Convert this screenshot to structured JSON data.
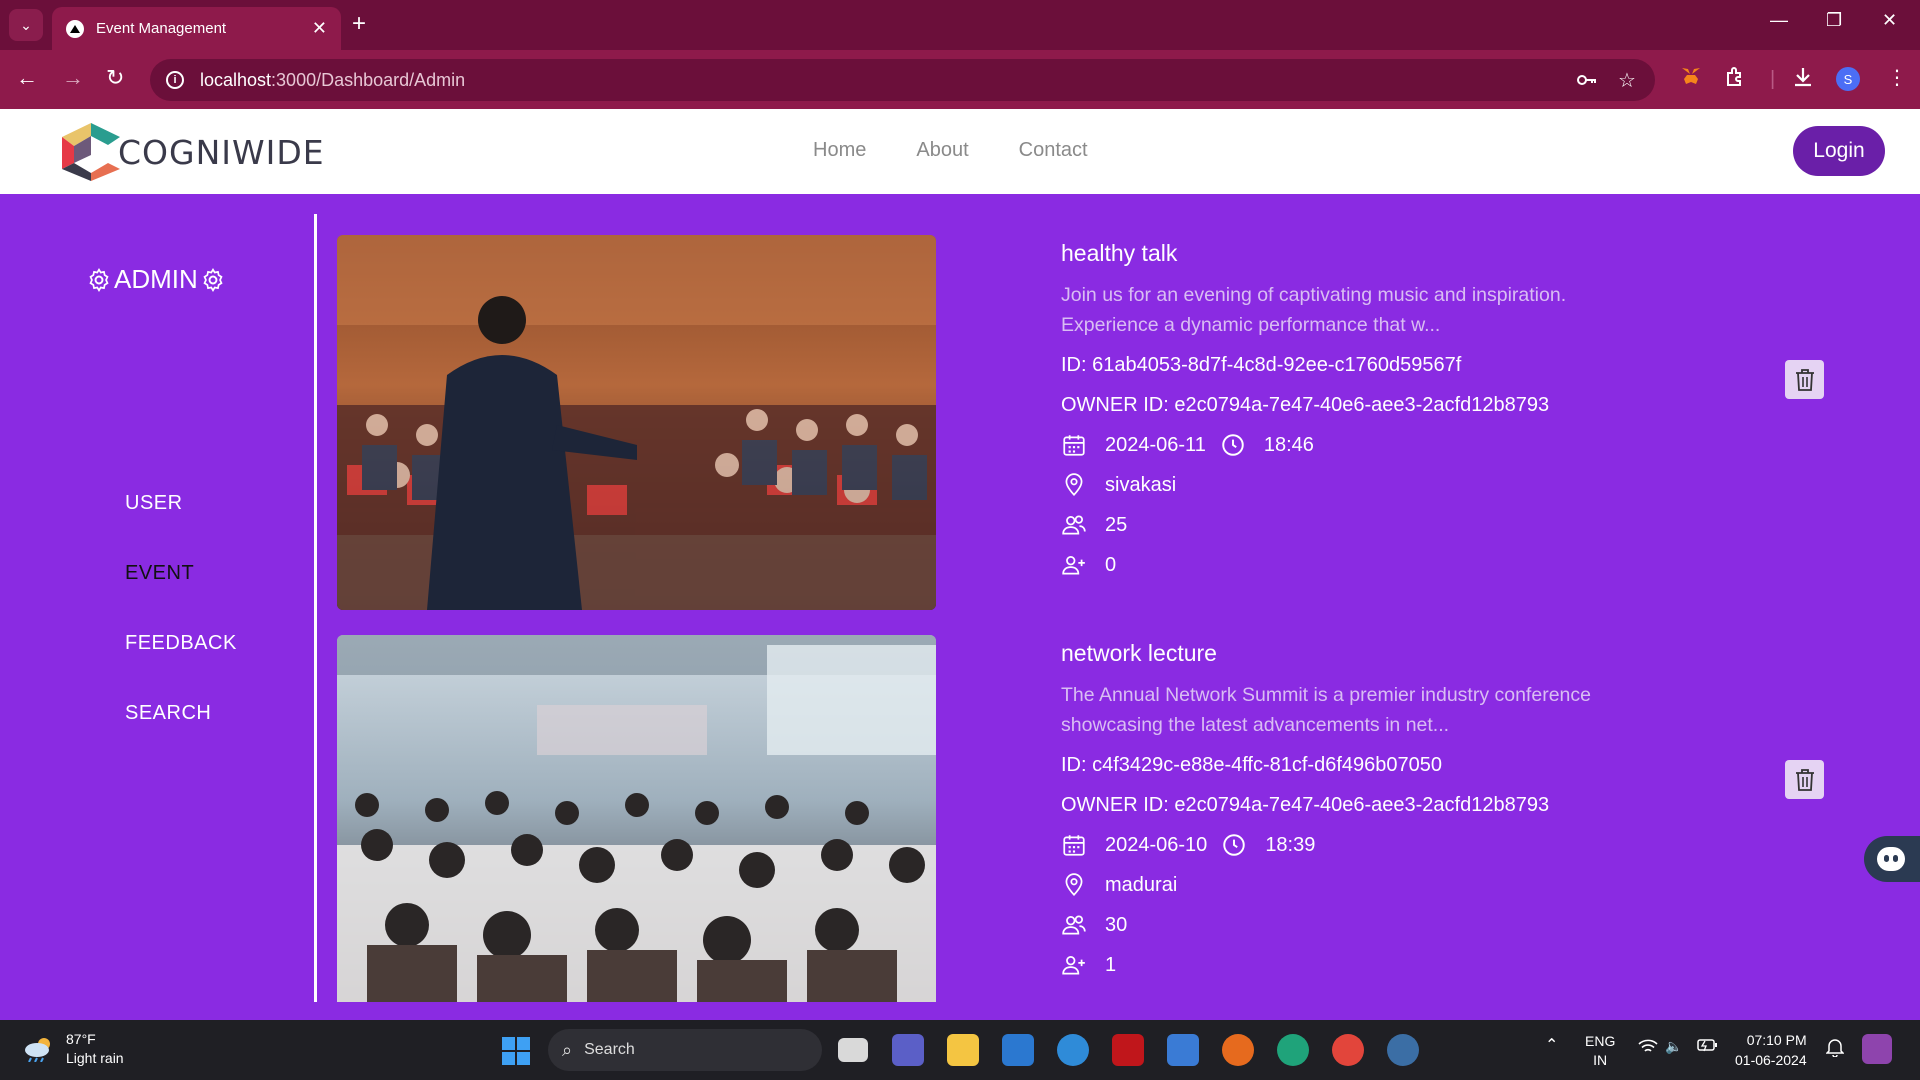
{
  "browser": {
    "tab_title": "Event Management",
    "url_host": "localhost",
    "url_path": ":3000/Dashboard/Admin",
    "profile_initial": "S"
  },
  "site": {
    "logo_text": "COGNIWIDE",
    "nav": [
      "Home",
      "About",
      "Contact"
    ],
    "login_label": "Login"
  },
  "sidebar": {
    "title": "ADMIN",
    "items": [
      "USER",
      "EVENT",
      "FEEDBACK",
      "SEARCH"
    ],
    "active": "EVENT"
  },
  "events": [
    {
      "title": "healthy talk",
      "description_line1": "Join us for an evening of captivating music and inspiration.",
      "description_line2": "Experience a dynamic performance that w...",
      "id": "ID: 61ab4053-8d7f-4c8d-92ee-c1760d59567f",
      "owner": "OWNER ID: e2c0794a-7e47-40e6-aee3-2acfd12b8793",
      "date": "2024-06-11",
      "time": "18:46",
      "location": "sivakasi",
      "capacity": "25",
      "registered": "0"
    },
    {
      "title": "network lecture",
      "description_line1": "The Annual Network Summit is a premier industry conference",
      "description_line2": "showcasing the latest advancements in net...",
      "id": "ID: c4f3429c-e88e-4ffc-81cf-d6f496b07050",
      "owner": "OWNER ID: e2c0794a-7e47-40e6-aee3-2acfd12b8793",
      "date": "2024-06-10",
      "time": "18:39",
      "location": "madurai",
      "capacity": "30",
      "registered": "1"
    }
  ],
  "taskbar": {
    "weather_temp": "87°F",
    "weather_desc": "Light rain",
    "search_label": "Search",
    "lang_line1": "ENG",
    "lang_line2": "IN",
    "time": "07:10 PM",
    "date": "01-06-2024"
  },
  "colors": {
    "page_bg": "#8a2be2",
    "login_bg": "#6a1fa8",
    "browser_frame": "#6b0f3a"
  }
}
